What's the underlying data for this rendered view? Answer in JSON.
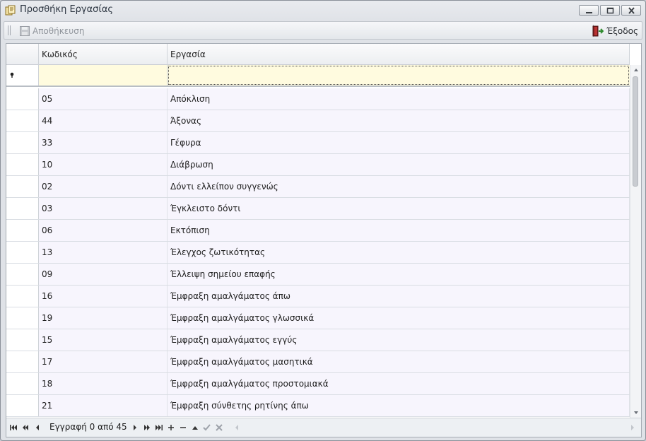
{
  "window": {
    "title": "Προσθήκη Εργασίας"
  },
  "toolbar": {
    "save_label": "Αποθήκευση",
    "exit_label": "Έξοδος"
  },
  "grid": {
    "columns": [
      "Κωδικός",
      "Εργασία"
    ],
    "rows": [
      {
        "code": "05",
        "task": "Απόκλιση"
      },
      {
        "code": "44",
        "task": "Άξονας"
      },
      {
        "code": "33",
        "task": "Γέφυρα"
      },
      {
        "code": "10",
        "task": "Διάβρωση"
      },
      {
        "code": "02",
        "task": "Δόντι ελλείπον συγγενώς"
      },
      {
        "code": "03",
        "task": "Έγκλειστο δόντι"
      },
      {
        "code": "06",
        "task": "Εκτόπιση"
      },
      {
        "code": "13",
        "task": "Έλεγχος ζωτικότητας"
      },
      {
        "code": "09",
        "task": "Έλλειψη σημείου επαφής"
      },
      {
        "code": "16",
        "task": "Έμφραξη αμαλγάματος άπω"
      },
      {
        "code": "19",
        "task": "Έμφραξη αμαλγάματος γλωσσικά"
      },
      {
        "code": "15",
        "task": "Έμφραξη αμαλγάματος εγγύς"
      },
      {
        "code": "17",
        "task": "Έμφραξη αμαλγάματος μασητικά"
      },
      {
        "code": "18",
        "task": "Έμφραξη αμαλγάματος προστομιακά"
      },
      {
        "code": "21",
        "task": "Έμφραξη σύνθετης ρητίνης άπω"
      }
    ]
  },
  "navigator": {
    "record_text": "Εγγραφή 0 από 45"
  },
  "colors": {
    "new_row_bg": "#fffbdf",
    "row_bg": "#f7f5fd"
  }
}
